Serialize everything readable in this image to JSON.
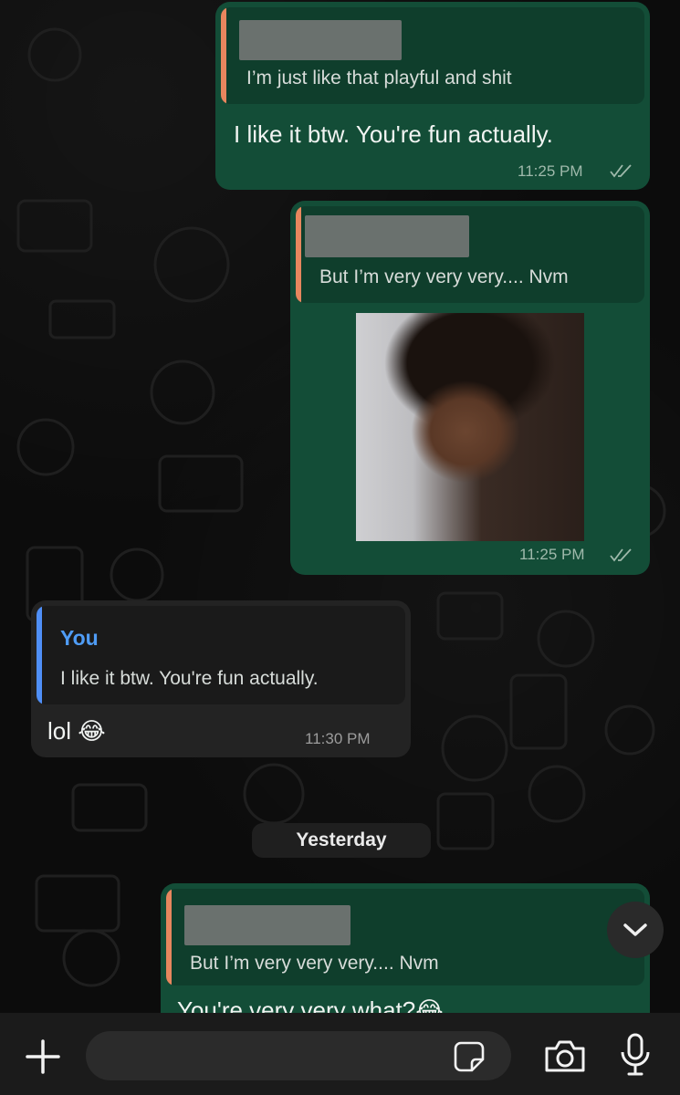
{
  "messages": [
    {
      "direction": "outgoing",
      "quote": {
        "author": "",
        "text": "I’m just like that playful and shit"
      },
      "text": "I like it btw. You're fun actually.",
      "time": "11:25 PM"
    },
    {
      "direction": "outgoing",
      "quote": {
        "author": "",
        "text": "But I’m very very very.... Nvm"
      },
      "has_photo": true,
      "time": "11:25 PM"
    },
    {
      "direction": "incoming",
      "quote": {
        "author": "You",
        "text": "I like it btw. You're fun actually."
      },
      "text": "lol 😂",
      "time": "11:30 PM"
    },
    {
      "direction": "outgoing",
      "quote": {
        "author": "",
        "text": "But I’m very very very.... Nvm"
      },
      "text": "You're very very what?😂",
      "time": ""
    }
  ],
  "date_separator": "Yesterday",
  "composer": {
    "placeholder": ""
  },
  "icons": {
    "attach": "plus-icon",
    "sticker": "sticker-icon",
    "camera": "camera-icon",
    "mic": "microphone-icon",
    "scroll": "chevron-down-icon",
    "read_receipt": "double-check-icon"
  },
  "colors": {
    "outgoing_bubble": "#134d37",
    "incoming_bubble": "#232323",
    "quote_bar_outgoing": "#e8865e",
    "quote_bar_incoming": "#4f8ff7",
    "author_name": "#4f9cf5"
  }
}
